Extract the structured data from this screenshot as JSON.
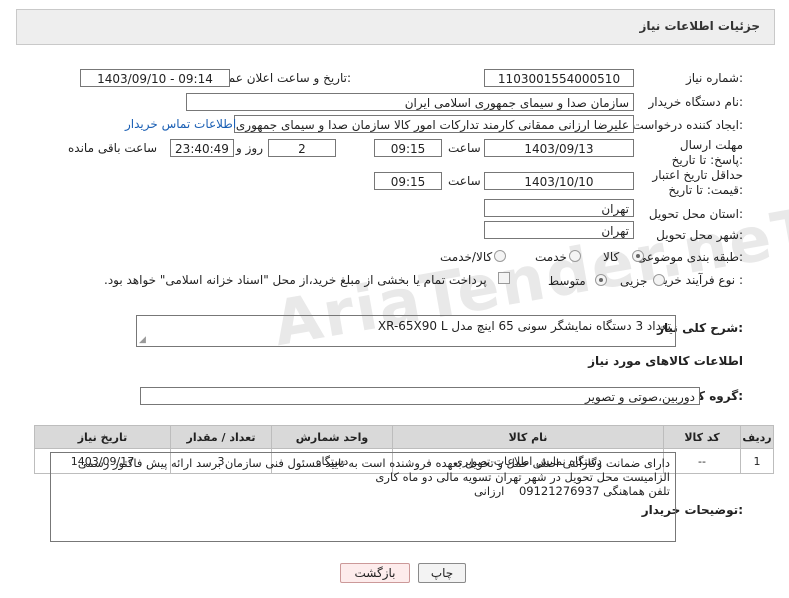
{
  "header": {
    "title": "جزئیات اطلاعات نیاز"
  },
  "fields": {
    "need_number_label": "شماره نیاز:",
    "need_number": "1103001554000510",
    "announce_datetime_label": "تاریخ و ساعت اعلان عمومی:",
    "announce_datetime": "1403/09/10 - 09:14",
    "buyer_org_label": "نام دستگاه خریدار:",
    "buyer_org": "سازمان صدا و سیمای جمهوری اسلامی ایران",
    "requester_label": "ایجاد کننده درخواست:",
    "requester": "علیرضا ارزانی ممقانی کارمند تدارکات امور کالا سازمان صدا و سیمای جمهوری ا",
    "buyer_contact_link": "اطلاعات تماس خریدار",
    "deadline_label": "مهلت ارسال پاسخ: تا تاریخ:",
    "deadline_date": "1403/09/13",
    "time_label": "ساعت",
    "deadline_time": "09:15",
    "days_value": "2",
    "days_label": "روز و",
    "remaining_time": "23:40:49",
    "remaining_label": "ساعت باقی مانده",
    "price_validity_label": "حداقل تاریخ اعتبار قیمت: تا تاریخ:",
    "price_validity_date": "1403/10/10",
    "price_validity_time": "09:15",
    "province_label": "استان محل تحویل:",
    "province": "تهران",
    "city_label": "شهر محل تحویل:",
    "city": "تهران",
    "category_label": "طبقه بندی موضوعی:",
    "category_options": [
      "کالا",
      "خدمت",
      "کالا/خدمت"
    ],
    "process_label": "نوع فرآیند خرید :",
    "process_options": [
      "جزیی",
      "متوسط"
    ],
    "payment_note": "پرداخت تمام یا بخشی از مبلغ خرید،از محل \"اسناد خزانه اسلامی\" خواهد بود.",
    "summary_label": "شرح کلی نیاز:",
    "summary": "تعداد 3 دستگاه نمایشگر سونی 65 اینچ مدل XR-65X90 L",
    "goods_info_title": "اطلاعات کالاهای مورد نیاز",
    "goods_group_label": "گروه کالا:",
    "goods_group": "دوربین،صوتی و تصویر",
    "buyer_notes_label": "توضیحات خریدار:",
    "buyer_notes": [
      "دارای ضمانت وگارانتی اصلی حمل و تحویل بعهده فروشنده است به تایید مسئول فنی سازمان برسد ارائه پیش فاکتور رسمی",
      "الزامیست محل تحویل در شهر تهران تسویه مالی دو ماه کاری",
      "تلفن هماهنگی 09121276937    ارزانی"
    ]
  },
  "table": {
    "headers": [
      "ردیف",
      "کد کالا",
      "نام کالا",
      "واحد شمارش",
      "تعداد / مقدار",
      "تاریخ نیاز"
    ],
    "rows": [
      [
        "1",
        "--",
        "دستگاه نمایش اطلاعات تصویری",
        "دستگاه",
        "3",
        "1403/09/17"
      ]
    ]
  },
  "buttons": {
    "print": "چاپ",
    "back": "بازگشت"
  },
  "watermark": "AriaTender.neT"
}
